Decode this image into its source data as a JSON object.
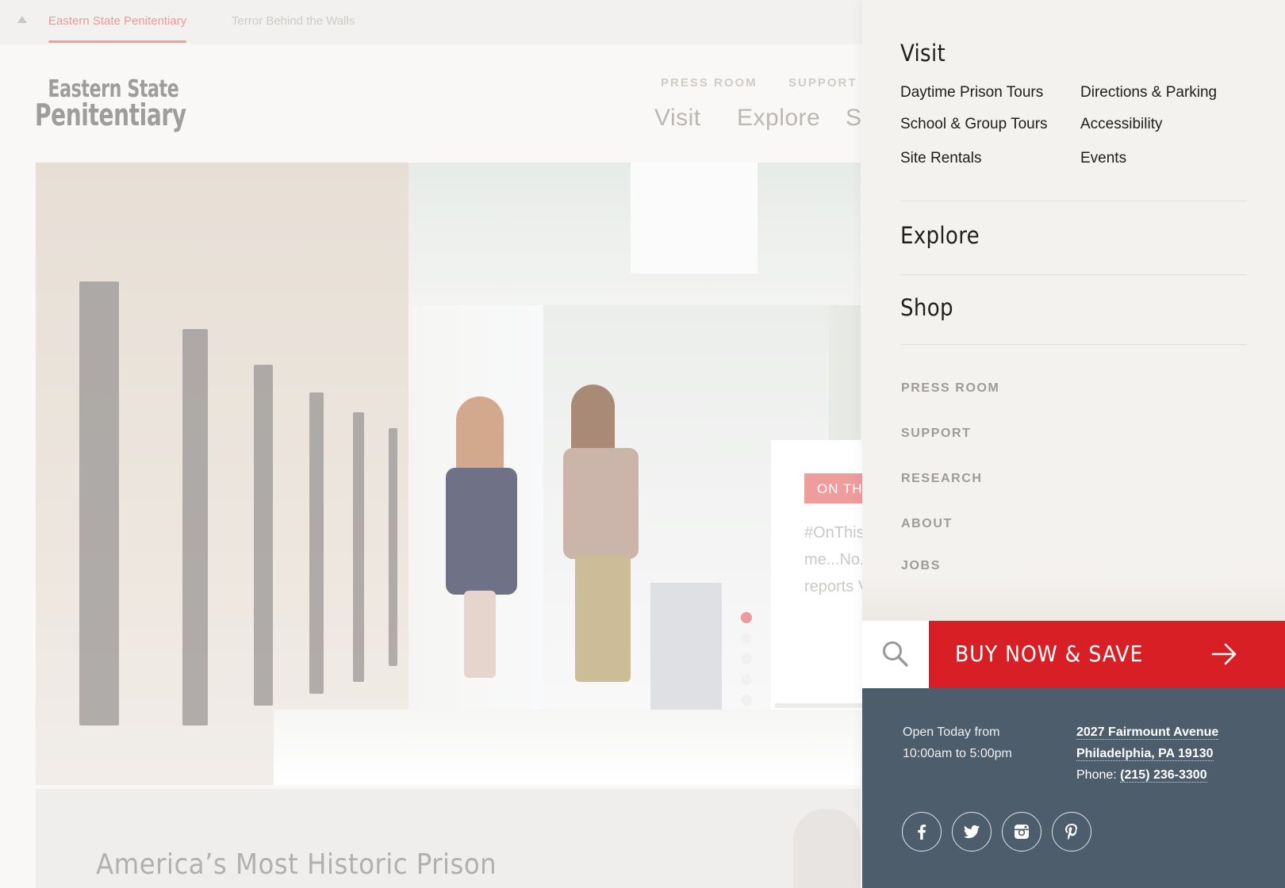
{
  "topbar": {
    "tabs": [
      {
        "label": "Eastern State Penitentiary",
        "active": true
      },
      {
        "label": "Terror Behind the Walls",
        "active": false
      }
    ]
  },
  "logo": {
    "line1": "Eastern State",
    "line2": "Penitentiary"
  },
  "header": {
    "utility_nav": [
      "PRESS ROOM",
      "SUPPORT"
    ],
    "main_nav": [
      "Visit",
      "Explore",
      "Sh"
    ]
  },
  "hero": {
    "badge": "ON THIS",
    "excerpt_lines": [
      "#OnThis",
      "me...No.",
      "reports V"
    ]
  },
  "tagline": "America’s Most Historic Prison",
  "menu": {
    "sections": {
      "visit": {
        "heading": "Visit",
        "links": [
          "Daytime Prison Tours",
          "School & Group Tours",
          "Site Rentals",
          "Directions & Parking",
          "Accessibility",
          "Events"
        ]
      },
      "explore": {
        "heading": "Explore"
      },
      "shop": {
        "heading": "Shop"
      }
    },
    "utility_links": [
      "PRESS ROOM",
      "SUPPORT",
      "RESEARCH",
      "ABOUT",
      "JOBS"
    ],
    "buy_label": "BUY NOW & SAVE",
    "info": {
      "hours_line1": "Open Today from",
      "hours_line2": "10:00am to 5:00pm",
      "address_line1": "2027 Fairmount Avenue",
      "address_line2": "Philadelphia, PA 19130",
      "phone_label": "Phone:",
      "phone": "(215) 236-3300"
    },
    "social": [
      "facebook-icon",
      "twitter-icon",
      "instagram-icon",
      "pinterest-icon"
    ]
  },
  "colors": {
    "buy_red": "#d81f26",
    "info_slate": "#4e5d6c",
    "menu_bg": "#f4f2ef",
    "active_tab": "#e89a9b"
  }
}
